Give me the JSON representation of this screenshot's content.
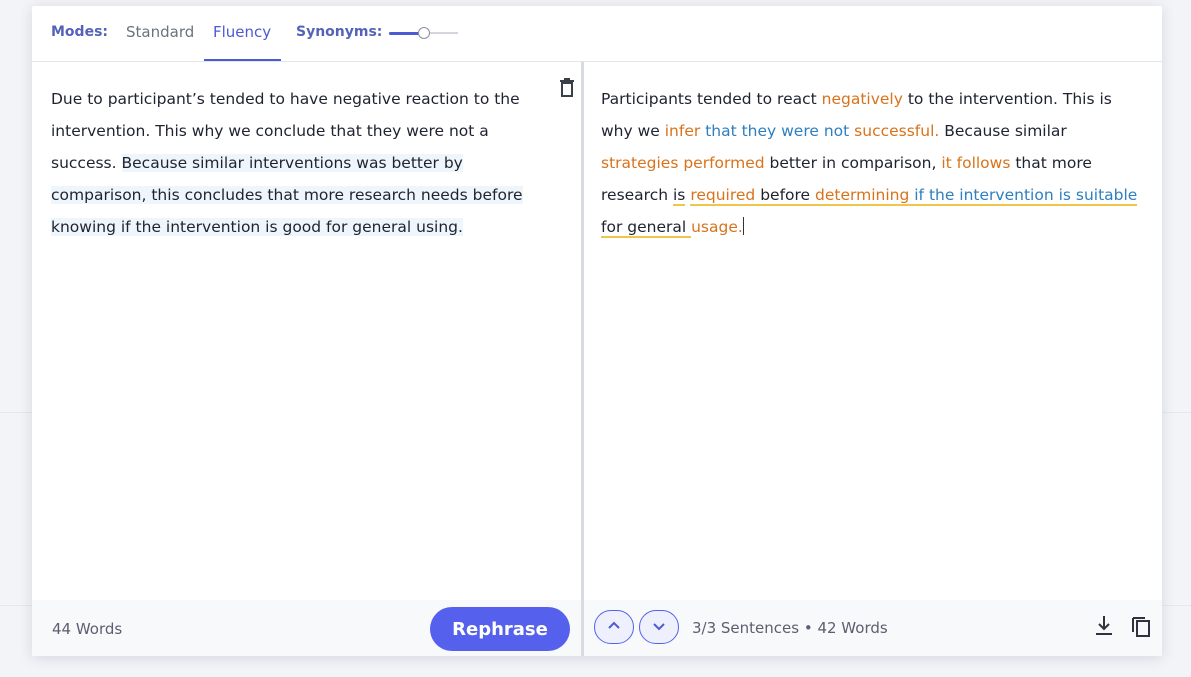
{
  "modes": {
    "label": "Modes:",
    "tabs": [
      {
        "label": "Standard",
        "active": false
      },
      {
        "label": "Fluency",
        "active": true
      }
    ],
    "synonyms_label": "Synonyms:",
    "synonyms_level": 0.5
  },
  "input": {
    "sentences": [
      "Due to participant’s tended to have negative reaction to the intervention. This why we conclude that they were not a success.",
      "Because similar interventions was better by comparison, this concludes that more research needs before knowing if the intervention is good for general using."
    ],
    "word_count": "44 Words",
    "rephrase_label": "Rephrase"
  },
  "output": {
    "s1": {
      "a": "Participants tended to react ",
      "b": "negatively",
      "c": " to the intervention. This is why we ",
      "d": "infer",
      "e": " ",
      "f": "that they were not",
      "g": " ",
      "h": "successful."
    },
    "s2": {
      "a": "Because similar ",
      "b": "strategies performed",
      "c": " better in comparison, ",
      "d": "it follows",
      "e": " that more research ",
      "f": "is",
      "g": " ",
      "h": "required",
      "i": " before ",
      "j": "determining",
      "k": " ",
      "l": "if the intervention is suitable",
      "m": " for general ",
      "n": "usage."
    },
    "stats": "3/3 Sentences • 42 Words"
  },
  "colors": {
    "accent": "#5561ec",
    "changed_word": "#d9731a",
    "structural_change": "#2c7fc0",
    "highlight": "#eef6fc"
  },
  "icons": [
    "trash-icon",
    "chevron-up-icon",
    "chevron-down-icon",
    "download-icon",
    "copy-icon"
  ]
}
